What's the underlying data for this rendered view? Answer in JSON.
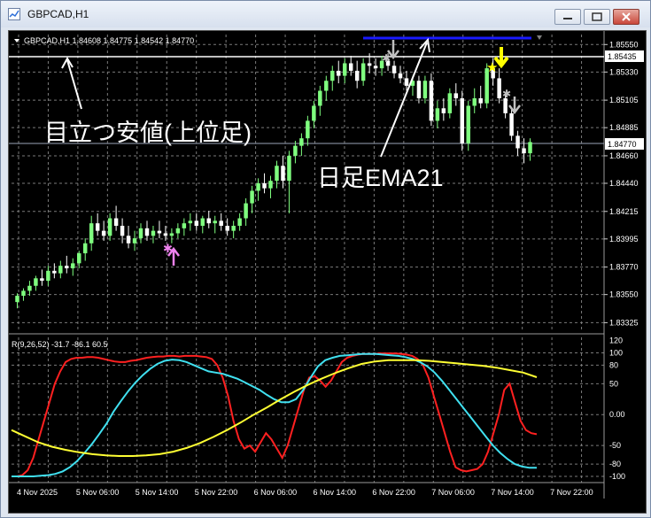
{
  "window": {
    "title": "GBPCAD,H1"
  },
  "main_chart": {
    "info": "GBPCAD,H1  1.84608 1.84775 1.84542 1.84770",
    "price_ticks": [
      "1.85550",
      "1.85330",
      "1.85105",
      "1.84885",
      "1.84660",
      "1.84440",
      "1.84215",
      "1.83995",
      "1.83770",
      "1.83550",
      "1.83325"
    ],
    "price_tags": {
      "white_line": "1.85435",
      "bid_line": "1.84770"
    },
    "annotations": {
      "cheap_label": "目立つ安値(上位足)",
      "ema_label": "日足EMA21"
    }
  },
  "oscillator": {
    "info": "R(9,26,52) -31.7 -86.1 60.5",
    "ticks": [
      "120",
      "100",
      "80",
      "50",
      "0.00",
      "-50",
      "-80",
      "-100"
    ]
  },
  "time_axis": {
    "labels": [
      "4 Nov 2025",
      "5 Nov 06:00",
      "5 Nov 14:00",
      "5 Nov 22:00",
      "6 Nov 06:00",
      "6 Nov 14:00",
      "6 Nov 22:00",
      "7 Nov 06:00",
      "7 Nov 14:00",
      "7 Nov 22:00"
    ]
  },
  "colors": {
    "bull": "#7fff7f",
    "bear": "#ffffff",
    "grid": "#7a7a7a",
    "ema_line": "#1a1aff",
    "series_fast": "#ff2020",
    "series_mid": "#40e0f0",
    "series_slow": "#ffff33",
    "buy_arrow": "#ee82ee",
    "sell_arrow_gray": "#c0c0c0",
    "sell_arrow_yellow": "#ffff00"
  },
  "chart_data": [
    {
      "type": "candlestick",
      "symbol": "GBPCAD",
      "timeframe": "H1",
      "ylim": [
        1.8325,
        1.8563
      ],
      "ohlc": [
        [
          1.8349,
          1.8356,
          1.8344,
          1.8354
        ],
        [
          1.8354,
          1.836,
          1.835,
          1.8358
        ],
        [
          1.8358,
          1.8366,
          1.8354,
          1.8362
        ],
        [
          1.8362,
          1.837,
          1.8358,
          1.8368
        ],
        [
          1.8368,
          1.8375,
          1.8362,
          1.8366
        ],
        [
          1.8366,
          1.8378,
          1.8362,
          1.8374
        ],
        [
          1.8374,
          1.838,
          1.8368,
          1.8372
        ],
        [
          1.8372,
          1.8382,
          1.8368,
          1.8378
        ],
        [
          1.8378,
          1.8386,
          1.8372,
          1.8376
        ],
        [
          1.8376,
          1.8384,
          1.837,
          1.838
        ],
        [
          1.838,
          1.839,
          1.8376,
          1.8388
        ],
        [
          1.8388,
          1.84,
          1.8382,
          1.8396
        ],
        [
          1.8396,
          1.8418,
          1.839,
          1.8412
        ],
        [
          1.8412,
          1.842,
          1.8402,
          1.8406
        ],
        [
          1.8406,
          1.8414,
          1.8398,
          1.8402
        ],
        [
          1.8402,
          1.842,
          1.8398,
          1.8416
        ],
        [
          1.8416,
          1.8426,
          1.8406,
          1.841
        ],
        [
          1.841,
          1.8416,
          1.8396,
          1.8402
        ],
        [
          1.8402,
          1.841,
          1.8392,
          1.8396
        ],
        [
          1.8396,
          1.8406,
          1.839,
          1.84
        ],
        [
          1.84,
          1.8412,
          1.8396,
          1.8408
        ],
        [
          1.8408,
          1.8414,
          1.8398,
          1.8402
        ],
        [
          1.8402,
          1.841,
          1.8396,
          1.8406
        ],
        [
          1.8406,
          1.8414,
          1.84,
          1.8404
        ],
        [
          1.8404,
          1.841,
          1.8398,
          1.8402
        ],
        [
          1.8402,
          1.8408,
          1.8396,
          1.8404
        ],
        [
          1.8404,
          1.8412,
          1.84,
          1.8408
        ],
        [
          1.8408,
          1.8416,
          1.8402,
          1.8412
        ],
        [
          1.8412,
          1.842,
          1.8406,
          1.8414
        ],
        [
          1.8414,
          1.842,
          1.8406,
          1.841
        ],
        [
          1.841,
          1.8418,
          1.8404,
          1.8416
        ],
        [
          1.8416,
          1.8422,
          1.8408,
          1.8412
        ],
        [
          1.8412,
          1.8418,
          1.8404,
          1.8414
        ],
        [
          1.8414,
          1.842,
          1.8406,
          1.841
        ],
        [
          1.841,
          1.8416,
          1.8402,
          1.8406
        ],
        [
          1.8406,
          1.8414,
          1.84,
          1.841
        ],
        [
          1.841,
          1.842,
          1.8406,
          1.8416
        ],
        [
          1.8416,
          1.8432,
          1.841,
          1.8428
        ],
        [
          1.8428,
          1.8442,
          1.842,
          1.8438
        ],
        [
          1.8438,
          1.8448,
          1.843,
          1.8444
        ],
        [
          1.8444,
          1.8452,
          1.8436,
          1.844
        ],
        [
          1.844,
          1.845,
          1.8432,
          1.8446
        ],
        [
          1.8446,
          1.8462,
          1.844,
          1.8458
        ],
        [
          1.8458,
          1.8466,
          1.844,
          1.8446
        ],
        [
          1.8446,
          1.847,
          1.842,
          1.8466
        ],
        [
          1.8466,
          1.8478,
          1.846,
          1.8474
        ],
        [
          1.8474,
          1.8484,
          1.8466,
          1.848
        ],
        [
          1.848,
          1.8498,
          1.8474,
          1.8494
        ],
        [
          1.8494,
          1.851,
          1.8488,
          1.8506
        ],
        [
          1.8506,
          1.8522,
          1.8498,
          1.8518
        ],
        [
          1.8518,
          1.853,
          1.851,
          1.8526
        ],
        [
          1.8526,
          1.8538,
          1.8518,
          1.8534
        ],
        [
          1.8534,
          1.8542,
          1.8524,
          1.853
        ],
        [
          1.853,
          1.8544,
          1.8524,
          1.854
        ],
        [
          1.854,
          1.8546,
          1.853,
          1.8534
        ],
        [
          1.8534,
          1.8542,
          1.852,
          1.8526
        ],
        [
          1.8526,
          1.8544,
          1.8522,
          1.854
        ],
        [
          1.854,
          1.8548,
          1.8532,
          1.8538
        ],
        [
          1.8538,
          1.8544,
          1.853,
          1.8536
        ],
        [
          1.8536,
          1.8546,
          1.853,
          1.8542
        ],
        [
          1.8542,
          1.8548,
          1.8534,
          1.8538
        ],
        [
          1.8538,
          1.8542,
          1.8528,
          1.8532
        ],
        [
          1.8532,
          1.8538,
          1.8524,
          1.8528
        ],
        [
          1.8528,
          1.8534,
          1.8518,
          1.8522
        ],
        [
          1.8522,
          1.853,
          1.8514,
          1.8526
        ],
        [
          1.8526,
          1.853,
          1.8508,
          1.8512
        ],
        [
          1.8512,
          1.853,
          1.8508,
          1.8526
        ],
        [
          1.8526,
          1.8532,
          1.849,
          1.8494
        ],
        [
          1.8494,
          1.851,
          1.8488,
          1.8504
        ],
        [
          1.8504,
          1.8512,
          1.8494,
          1.85
        ],
        [
          1.85,
          1.852,
          1.8496,
          1.8516
        ],
        [
          1.8516,
          1.8524,
          1.8506,
          1.8512
        ],
        [
          1.8512,
          1.8518,
          1.847,
          1.8476
        ],
        [
          1.8476,
          1.851,
          1.847,
          1.8506
        ],
        [
          1.8506,
          1.852,
          1.85,
          1.8512
        ],
        [
          1.8512,
          1.8522,
          1.8504,
          1.8508
        ],
        [
          1.8508,
          1.854,
          1.8504,
          1.8536
        ],
        [
          1.8536,
          1.8544,
          1.8522,
          1.8528
        ],
        [
          1.8528,
          1.8536,
          1.8508,
          1.8512
        ],
        [
          1.8512,
          1.8516,
          1.8496,
          1.85
        ],
        [
          1.85,
          1.8504,
          1.8478,
          1.8482
        ],
        [
          1.8482,
          1.8486,
          1.8466,
          1.8472
        ],
        [
          1.8472,
          1.848,
          1.846,
          1.8468
        ],
        [
          1.8468,
          1.848,
          1.8462,
          1.8477
        ]
      ]
    },
    {
      "type": "line",
      "ylim": [
        -110,
        125
      ],
      "series": [
        {
          "values": [
            -100,
            -100,
            -98,
            -90,
            -70,
            -40,
            -10,
            20,
            50,
            70,
            85,
            90,
            92,
            92,
            93,
            93,
            92,
            90,
            88,
            86,
            85,
            85,
            87,
            88,
            90,
            92,
            93,
            94,
            94,
            95,
            95,
            94,
            95,
            95,
            95,
            94,
            93,
            90,
            80,
            60,
            30,
            -10,
            -40,
            -55,
            -50,
            -60,
            -45,
            -30,
            -40,
            -55,
            -70,
            -50,
            -20,
            10,
            40,
            60,
            62,
            55,
            45,
            55,
            70,
            85,
            92,
            95,
            97,
            98,
            98,
            98,
            99,
            99,
            99,
            99,
            98,
            97,
            95,
            90,
            80,
            60,
            30,
            0,
            -30,
            -60,
            -85,
            -90,
            -92,
            -90,
            -88,
            -80,
            -60,
            -30,
            0,
            40,
            50,
            20,
            -10,
            -25,
            -30,
            -31.7
          ]
        },
        {
          "values": [
            -100,
            -100,
            -100,
            -100,
            -99,
            -98,
            -96,
            -92,
            -85,
            -75,
            -62,
            -48,
            -32,
            -15,
            5,
            22,
            38,
            52,
            64,
            74,
            82,
            87,
            89,
            88,
            85,
            80,
            75,
            70,
            68,
            66,
            62,
            58,
            52,
            46,
            40,
            32,
            25,
            20,
            20,
            25,
            40,
            60,
            78,
            88,
            92,
            95,
            96,
            97,
            98,
            98,
            98,
            97,
            96,
            95,
            93,
            90,
            85,
            78,
            68,
            55,
            40,
            25,
            10,
            -5,
            -20,
            -35,
            -50,
            -62,
            -72,
            -80,
            -84,
            -86,
            -86.1
          ]
        },
        {
          "values": [
            -25,
            -35,
            -45,
            -52,
            -57,
            -61,
            -64,
            -66,
            -67,
            -67,
            -66,
            -64,
            -60,
            -54,
            -46,
            -36,
            -25,
            -13,
            0,
            12,
            25,
            37,
            48,
            58,
            67,
            75,
            82,
            86,
            88,
            88,
            88,
            87,
            85,
            83,
            81,
            79,
            76,
            72,
            68,
            60.5
          ]
        }
      ]
    }
  ]
}
